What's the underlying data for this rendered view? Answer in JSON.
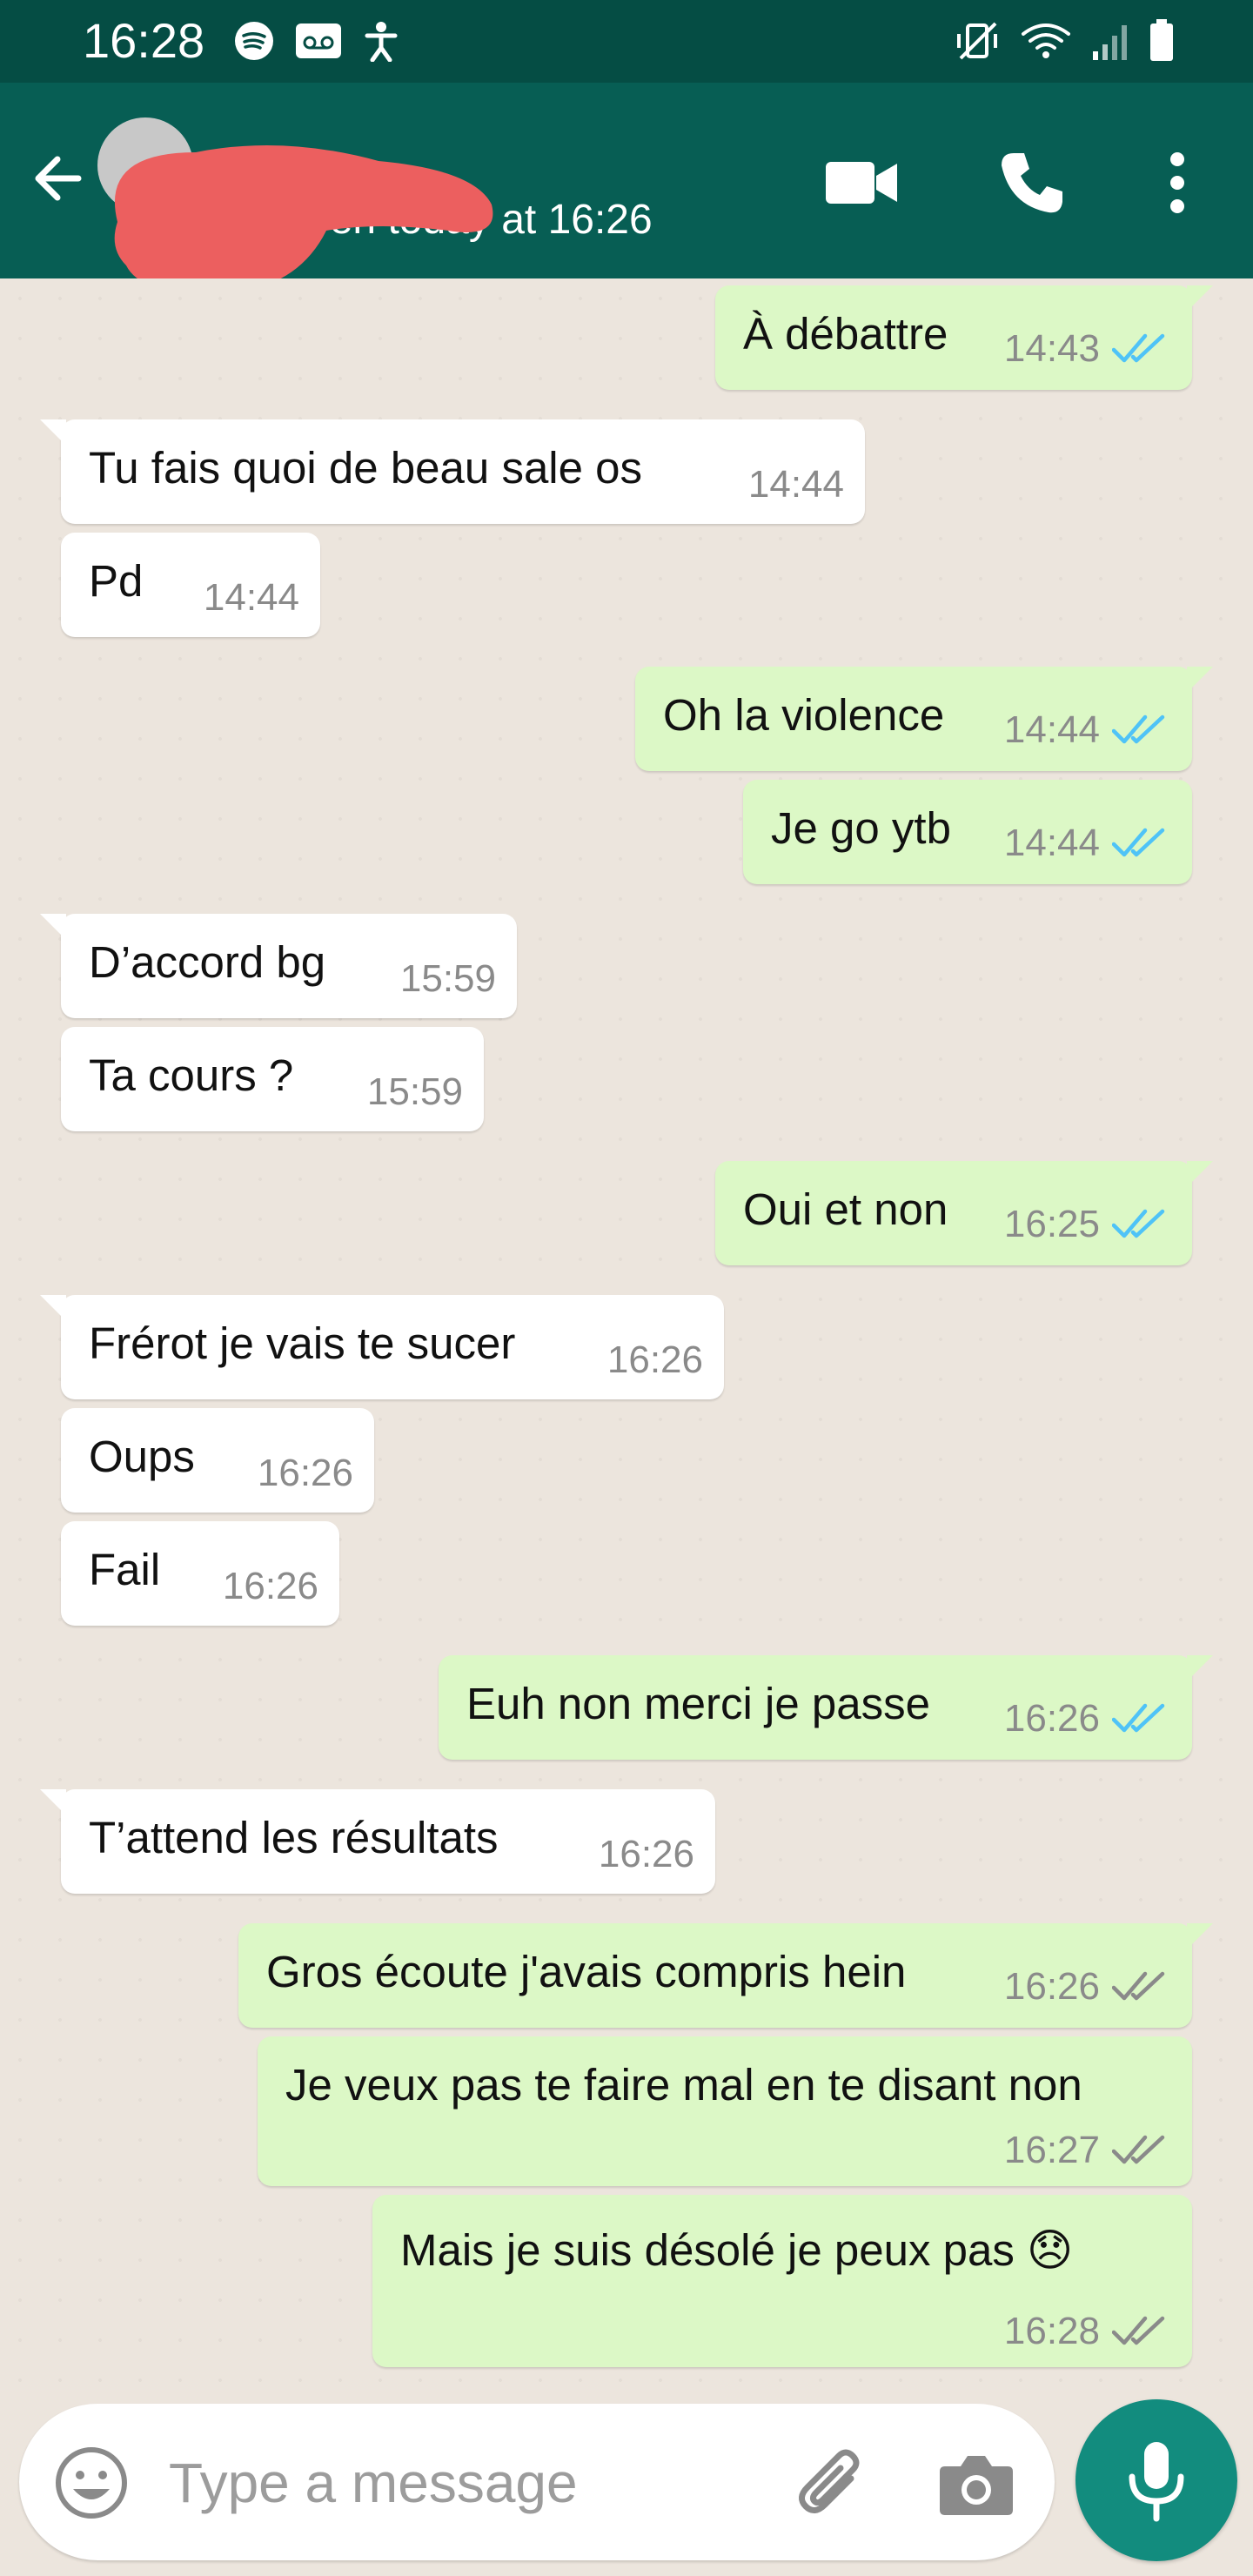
{
  "status_bar": {
    "time": "16:28"
  },
  "header": {
    "contact_name": "",
    "last_seen": "last seen today at 16:26"
  },
  "messages": [
    {
      "direction": "out",
      "text": "À débattre",
      "time": "14:43",
      "ticks": "read"
    },
    {
      "direction": "in",
      "text": "Tu fais quoi de beau sale os",
      "time": "14:44"
    },
    {
      "direction": "in",
      "text": "Pd",
      "time": "14:44"
    },
    {
      "direction": "out",
      "text": "Oh la violence",
      "time": "14:44",
      "ticks": "read"
    },
    {
      "direction": "out",
      "text": "Je go ytb",
      "time": "14:44",
      "ticks": "read"
    },
    {
      "direction": "in",
      "text": "D’accord bg",
      "time": "15:59"
    },
    {
      "direction": "in",
      "text": "Ta cours ?",
      "time": "15:59"
    },
    {
      "direction": "out",
      "text": "Oui et non",
      "time": "16:25",
      "ticks": "read"
    },
    {
      "direction": "in",
      "text": "Frérot je vais te sucer",
      "time": "16:26"
    },
    {
      "direction": "in",
      "text": "Oups",
      "time": "16:26"
    },
    {
      "direction": "in",
      "text": "Fail",
      "time": "16:26"
    },
    {
      "direction": "out",
      "text": "Euh non merci je passe",
      "time": "16:26",
      "ticks": "read"
    },
    {
      "direction": "in",
      "text": "T’attend les résultats",
      "time": "16:26"
    },
    {
      "direction": "out",
      "text": "Gros écoute j'avais compris hein",
      "time": "16:26",
      "ticks": "delivered"
    },
    {
      "direction": "out",
      "text": "Je veux pas te faire mal en te disant non",
      "time": "16:27",
      "ticks": "delivered"
    },
    {
      "direction": "out",
      "text": "Mais je suis désolé je peux pas 😞",
      "time": "16:28",
      "ticks": "delivered"
    }
  ],
  "composer": {
    "placeholder": "Type a message"
  },
  "icons": {
    "back": "arrow-left-icon",
    "video_call": "video-camera-icon",
    "voice_call": "phone-icon",
    "menu": "more-vertical-icon",
    "emoji": "smiley-icon",
    "attach": "paperclip-icon",
    "camera": "camera-icon",
    "mic": "microphone-icon"
  },
  "colors": {
    "header": "#075e54",
    "status_bar": "#054d44",
    "outgoing_bubble": "#dcf8c6",
    "incoming_bubble": "#ffffff",
    "read_ticks": "#4fc3f7",
    "delivered_ticks": "#8a8a8a",
    "mic_button": "#128c7e"
  }
}
